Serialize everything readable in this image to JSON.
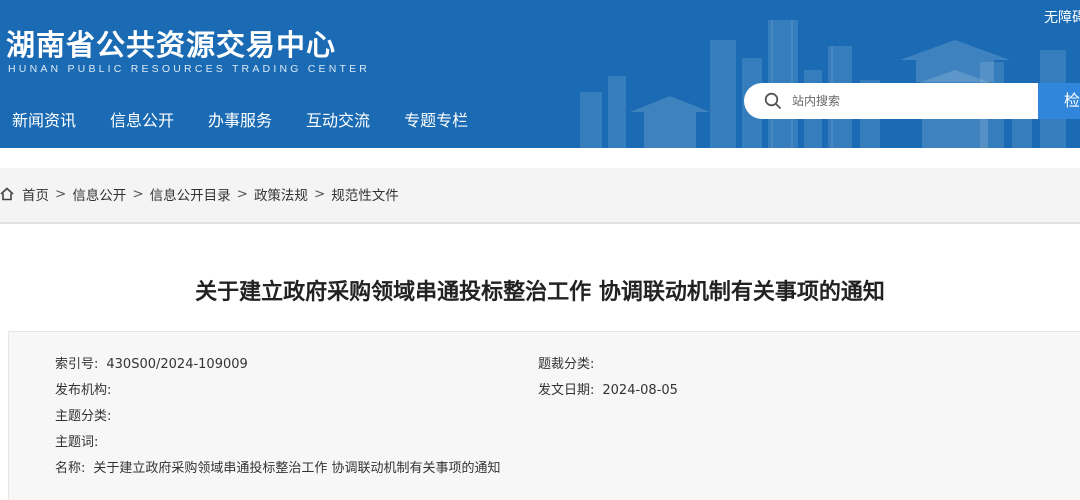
{
  "header": {
    "site_name_cn": "湖南省公共资源交易中心",
    "site_name_en": "HUNAN PUBLIC RESOURCES TRADING CENTER",
    "accessibility_label": "无障碍",
    "bg_color": "#1a6bb3"
  },
  "nav": {
    "items": [
      "新闻资讯",
      "信息公开",
      "办事服务",
      "互动交流",
      "专题专栏"
    ]
  },
  "search": {
    "placeholder": "站内搜索",
    "button_label": "检索",
    "button_color": "#2f86db"
  },
  "breadcrumb": {
    "home_icon": "home-icon",
    "items": [
      "首页",
      "信息公开",
      "信息公开目录",
      "政策法规",
      "规范性文件"
    ],
    "separator": ">"
  },
  "article": {
    "title": "关于建立政府采购领域串通投标整治工作 协调联动机制有关事项的通知"
  },
  "meta": {
    "index_label": "索引号:",
    "index_value": "430S00/2024-109009",
    "category_label": "题裁分类:",
    "category_value": "",
    "publisher_label": "发布机构:",
    "publisher_value": "",
    "date_label": "发文日期:",
    "date_value": "2024-08-05",
    "topic_label": "主题分类:",
    "topic_value": "",
    "keywords_label": "主题词:",
    "keywords_value": "",
    "name_label": "名称:",
    "name_value": "关于建立政府采购领域串通投标整治工作 协调联动机制有关事项的通知"
  }
}
